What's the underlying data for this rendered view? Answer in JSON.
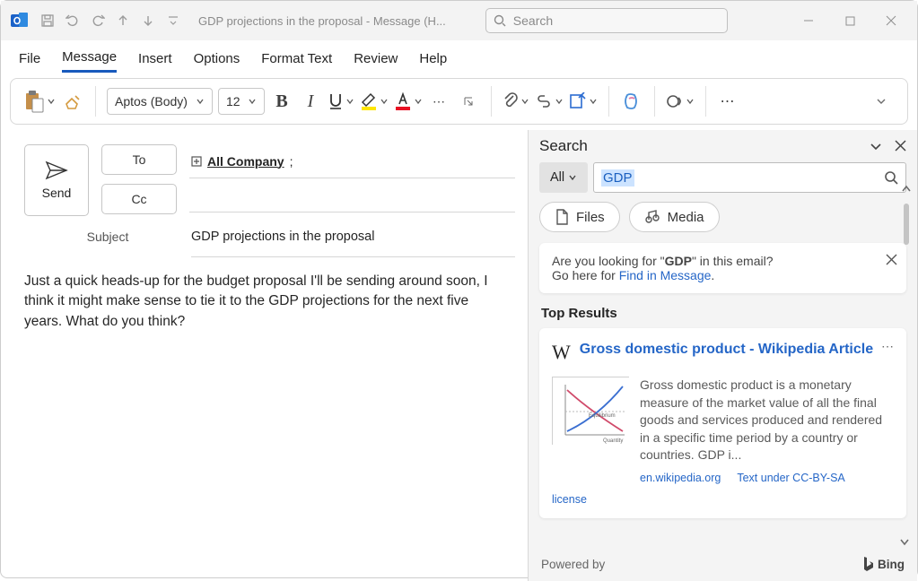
{
  "titlebar": {
    "title": "GDP projections in the proposal  -  Message (H...",
    "search_placeholder": "Search"
  },
  "menu": {
    "file": "File",
    "message": "Message",
    "insert": "Insert",
    "options": "Options",
    "format_text": "Format Text",
    "review": "Review",
    "help": "Help"
  },
  "ribbon": {
    "font_name": "Aptos (Body)",
    "font_size": "12"
  },
  "compose": {
    "send": "Send",
    "to": "To",
    "cc": "Cc",
    "all_company": "All Company",
    "subject_label": "Subject",
    "subject_value": "GDP projections in the proposal",
    "body": "Just a quick heads-up for the budget proposal I'll be sending around soon, I think it might make sense to tie it to the GDP projections for the next five years. What do you think?"
  },
  "search_pane": {
    "title": "Search",
    "scope": "All",
    "query": "GDP",
    "pill_files": "Files",
    "pill_media": "Media",
    "info_prefix": "Are you looking for \"",
    "info_term": "GDP",
    "info_suffix": "\" in this email?",
    "info_line2_prefix": "Go here for ",
    "info_link": "Find in Message",
    "top_results": "Top Results",
    "result": {
      "title": "Gross domestic product - Wikipedia Article",
      "desc": "Gross domestic product is a monetary measure of the market value of all the final goods and services produced and rendered in a specific time period by a country or countries. GDP i...",
      "source": "en.wikipedia.org",
      "rights": "Text under CC-BY-SA",
      "license": "license"
    },
    "powered_by": "Powered by",
    "bing": "Bing"
  }
}
